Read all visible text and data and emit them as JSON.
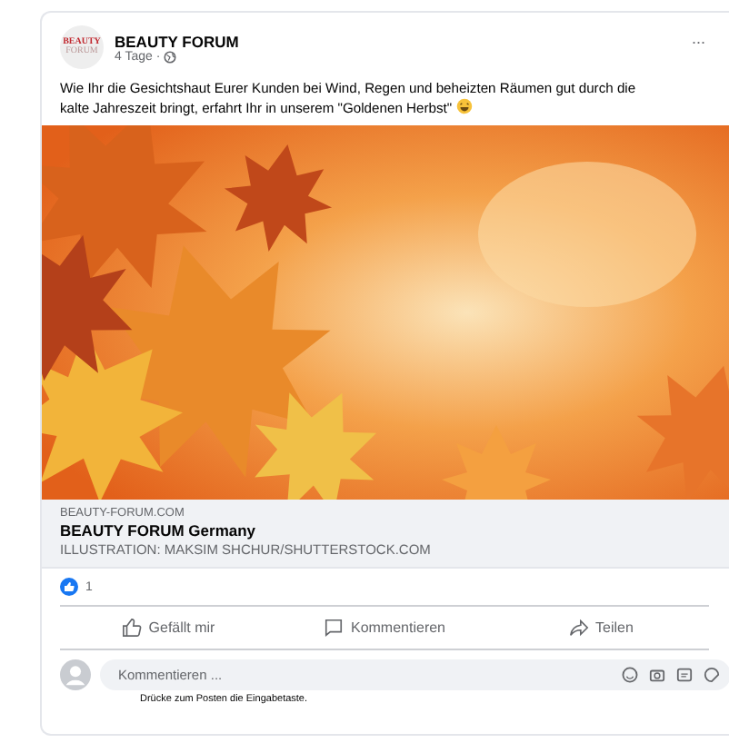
{
  "post": {
    "logo_lines": [
      "BEAUTY",
      "FORUM"
    ],
    "author": "BEAUTY FORUM",
    "time": "4 Tage ·",
    "menu": "...",
    "text": "Wie Ihr die Gesichtshaut Eurer Kunden bei Wind, Regen und beheizten Räumen gut durch die kalte Jahreszeit bringt, erfahrt Ihr in unserem \"Goldenen Herbst\""
  },
  "link": {
    "domain": "BEAUTY-FORUM.COM",
    "title": "BEAUTY FORUM Germany",
    "credit": "ILLUSTRATION: MAKSIM SHCHUR/SHUTTERSTOCK.COM"
  },
  "reactions": {
    "count": "1"
  },
  "actions": [
    {
      "kind": "like",
      "label": "Gefällt mir"
    },
    {
      "kind": "comment",
      "label": "Kommentieren"
    },
    {
      "kind": "share",
      "label": "Teilen"
    }
  ],
  "comment": {
    "placeholder": "Kommentieren ...",
    "hint": "Drücke zum Posten die Eingabetaste."
  }
}
